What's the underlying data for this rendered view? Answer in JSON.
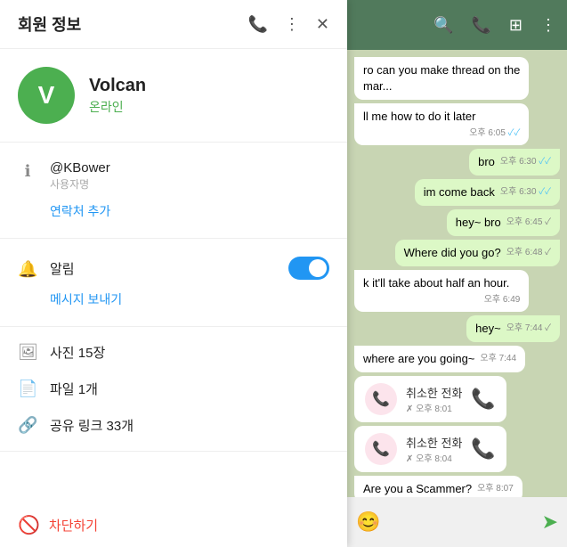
{
  "chat": {
    "header": {
      "title": "Volcan",
      "icons": [
        "search",
        "phone",
        "layout",
        "more"
      ]
    },
    "messages": [
      {
        "id": 1,
        "text": "ro can you make thread on the mar...",
        "type": "in",
        "time": "",
        "check": ""
      },
      {
        "id": 2,
        "text": "ll me how to do it later",
        "type": "in",
        "time": "오후 6:05",
        "check": "double"
      },
      {
        "id": 3,
        "text": "bro",
        "type": "out",
        "time": "오후 6:30",
        "check": "double"
      },
      {
        "id": 4,
        "text": "im come back",
        "type": "out",
        "time": "오후 6:30",
        "check": "double"
      },
      {
        "id": 5,
        "text": "hey~ bro",
        "type": "out",
        "time": "오후 6:45",
        "check": "single"
      },
      {
        "id": 6,
        "text": "Where did you go?",
        "type": "out",
        "time": "오후 6:48",
        "check": "single"
      },
      {
        "id": 7,
        "text": "k it'll take about half an hour.",
        "type": "in",
        "time": "오후 6:49",
        "check": ""
      },
      {
        "id": 8,
        "text": "hey~",
        "type": "out",
        "time": "오후 7:44",
        "check": "single"
      },
      {
        "id": 9,
        "text": "where are you going~",
        "type": "in",
        "time": "오후 7:44",
        "check": ""
      },
      {
        "id": 10,
        "text": "취소한 전화",
        "type": "call-in",
        "time": "오후 8:01",
        "check": ""
      },
      {
        "id": 11,
        "text": "취소한 전화",
        "type": "call-in",
        "time": "오후 8:04",
        "check": ""
      },
      {
        "id": 12,
        "text": "Are you a Scammer?",
        "type": "in",
        "time": "오후 8:07",
        "check": ""
      }
    ]
  },
  "panel": {
    "title": "회원 정보",
    "phone_icon": "📞",
    "more_icon": "⋮",
    "close_icon": "✕",
    "profile": {
      "initial": "V",
      "name": "Volcan",
      "status": "온라인"
    },
    "info": {
      "username": "@KBower",
      "username_label": "사용자명",
      "add_contact": "연락처 추가"
    },
    "notification": {
      "label": "알림",
      "enabled": true,
      "send_message": "메시지 보내기"
    },
    "media": {
      "photos": "사진 15장",
      "files": "파일 1개",
      "links": "공유 링크 33개"
    },
    "block": {
      "label": "차단하기"
    }
  }
}
